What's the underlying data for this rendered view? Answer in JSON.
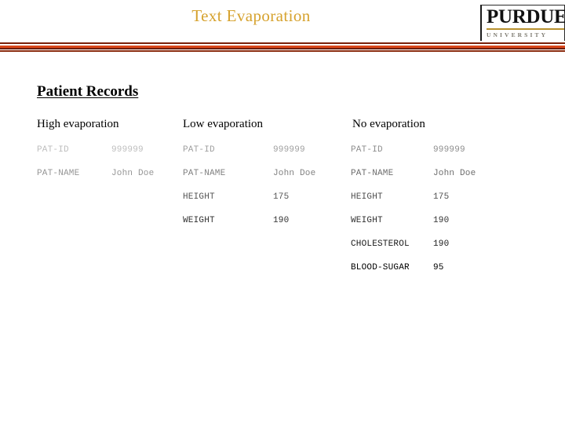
{
  "slide": {
    "title": "Text Evaporation",
    "section_heading": "Patient Records"
  },
  "logo": {
    "wordmark": "PURDUE",
    "subtext": "UNIVERSITY",
    "rule_color": "#b8912f"
  },
  "colors": {
    "title_gold": "#d6a22e",
    "divider_dark": "#7a1f08",
    "divider_bright": "#d9461a",
    "text_black": "#000000"
  },
  "columns": [
    {
      "header": "High evaporation",
      "rows": [
        {
          "label": "PAT-ID",
          "value": "999999",
          "opacity": 0.26
        },
        {
          "label": "PAT-NAME",
          "value": "John Doe",
          "opacity": 0.42
        }
      ]
    },
    {
      "header": "Low evaporation",
      "rows": [
        {
          "label": "PAT-ID",
          "value": "999999",
          "opacity": 0.38
        },
        {
          "label": "PAT-NAME",
          "value": "John Doe",
          "opacity": 0.5
        },
        {
          "label": "HEIGHT",
          "value": "175",
          "opacity": 0.68
        },
        {
          "label": "WEIGHT",
          "value": "190",
          "opacity": 0.82
        }
      ]
    },
    {
      "header": "No evaporation",
      "rows": [
        {
          "label": "PAT-ID",
          "value": "999999",
          "opacity": 0.45
        },
        {
          "label": "PAT-NAME",
          "value": "John Doe",
          "opacity": 0.58
        },
        {
          "label": "HEIGHT",
          "value": "175",
          "opacity": 0.7
        },
        {
          "label": "WEIGHT",
          "value": "190",
          "opacity": 0.82
        },
        {
          "label": "CHOLESTEROL",
          "value": "190",
          "opacity": 0.9
        },
        {
          "label": "BLOOD-SUGAR",
          "value": "95",
          "opacity": 1.0
        }
      ]
    }
  ]
}
